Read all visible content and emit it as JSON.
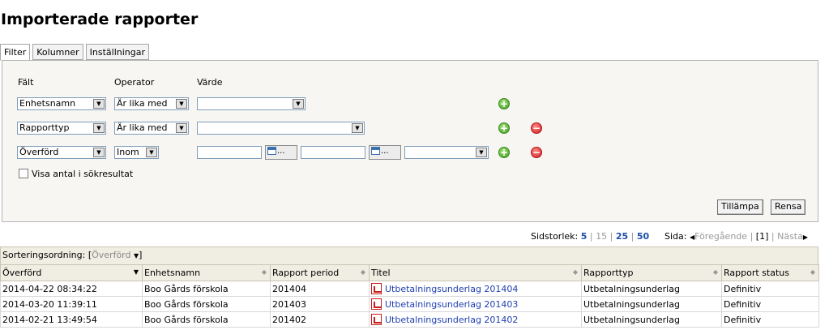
{
  "page": {
    "title": "Importerade rapporter"
  },
  "tabs": [
    {
      "label": "Filter"
    },
    {
      "label": "Kolumner"
    },
    {
      "label": "Inställningar"
    }
  ],
  "filter": {
    "headers": {
      "field": "Fält",
      "operator": "Operator",
      "value": "Värde"
    },
    "rows": [
      {
        "field": "Enhetsnamn",
        "operator": "Är lika med",
        "value": ""
      },
      {
        "field": "Rapporttyp",
        "operator": "Är lika med",
        "value": ""
      },
      {
        "field": "Överförd",
        "operator": "Inom",
        "from": "",
        "to": "",
        "period": ""
      }
    ],
    "calendar_button_label": "...",
    "show_count_label": "Visa antal i sökresultat",
    "apply_label": "Tillämpa",
    "clear_label": "Rensa",
    "add_icon": "plus-circle-icon",
    "remove_icon": "minus-circle-icon"
  },
  "pager": {
    "page_size_label": "Sidstorlek:",
    "sizes": [
      "5",
      "15",
      "25",
      "50"
    ],
    "page_label": "Sida:",
    "previous": "Föregående",
    "current": "[1]",
    "next": "Nästa"
  },
  "sort": {
    "label": "Sorteringsordning:",
    "value": "Överförd"
  },
  "table": {
    "columns": [
      "Överförd",
      "Enhetsnamn",
      "Rapport period",
      "Titel",
      "Rapporttyp",
      "Rapport status"
    ],
    "rows": [
      {
        "transferred": "2014-04-22 08:34:22",
        "unit": "Boo Gårds förskola",
        "period": "201404",
        "title": "Utbetalningsunderlag 201404",
        "type": "Utbetalningsunderlag",
        "status": "Definitiv"
      },
      {
        "transferred": "2014-03-20 11:39:11",
        "unit": "Boo Gårds förskola",
        "period": "201403",
        "title": "Utbetalningsunderlag 201403",
        "type": "Utbetalningsunderlag",
        "status": "Definitiv"
      },
      {
        "transferred": "2014-02-21 13:49:54",
        "unit": "Boo Gårds förskola",
        "period": "201402",
        "title": "Utbetalningsunderlag 201402",
        "type": "Utbetalningsunderlag",
        "status": "Definitiv"
      }
    ]
  }
}
